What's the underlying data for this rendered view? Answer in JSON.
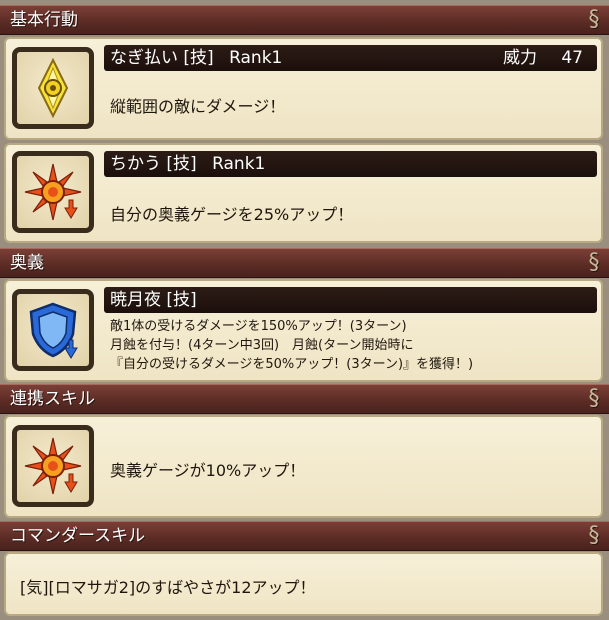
{
  "sections": {
    "basic": "基本行動",
    "ougi": "奥義",
    "renkei": "連携スキル",
    "commander": "コマンダースキル"
  },
  "skills": {
    "nagibarai": {
      "name": "なぎ払い [技]",
      "rank": "Rank1",
      "power_label": "威力",
      "power_value": "47",
      "desc": "縦範囲の敵にダメージ！"
    },
    "chikau": {
      "name": "ちかう [技]",
      "rank": "Rank1",
      "desc": "自分の奥義ゲージを25%アップ！"
    },
    "gyougetsuya": {
      "name": "暁月夜 [技]",
      "desc_lines": [
        "敵1体の受けるダメージを150%アップ！(3ターン)",
        "月蝕を付与！(4ターン中3回)　月蝕(ターン開始時に",
        "『自分の受けるダメージを50%アップ！(3ターン)』を獲得！)"
      ]
    },
    "renkei": {
      "desc": "奥義ゲージが10%アップ！"
    },
    "commander": {
      "desc": "[気][ロマサガ2]のすばやさが12アップ！"
    }
  },
  "icons": {
    "nagibarai": "eye-diamond-icon",
    "chikau": "sun-burst-arrow-icon",
    "gyougetsuya": "shield-arrow-icon",
    "renkei": "sun-burst-arrow-icon"
  },
  "colors": {
    "header": "#5a2b24",
    "panel": "#f3ead0",
    "title_bar": "#1f120d"
  }
}
